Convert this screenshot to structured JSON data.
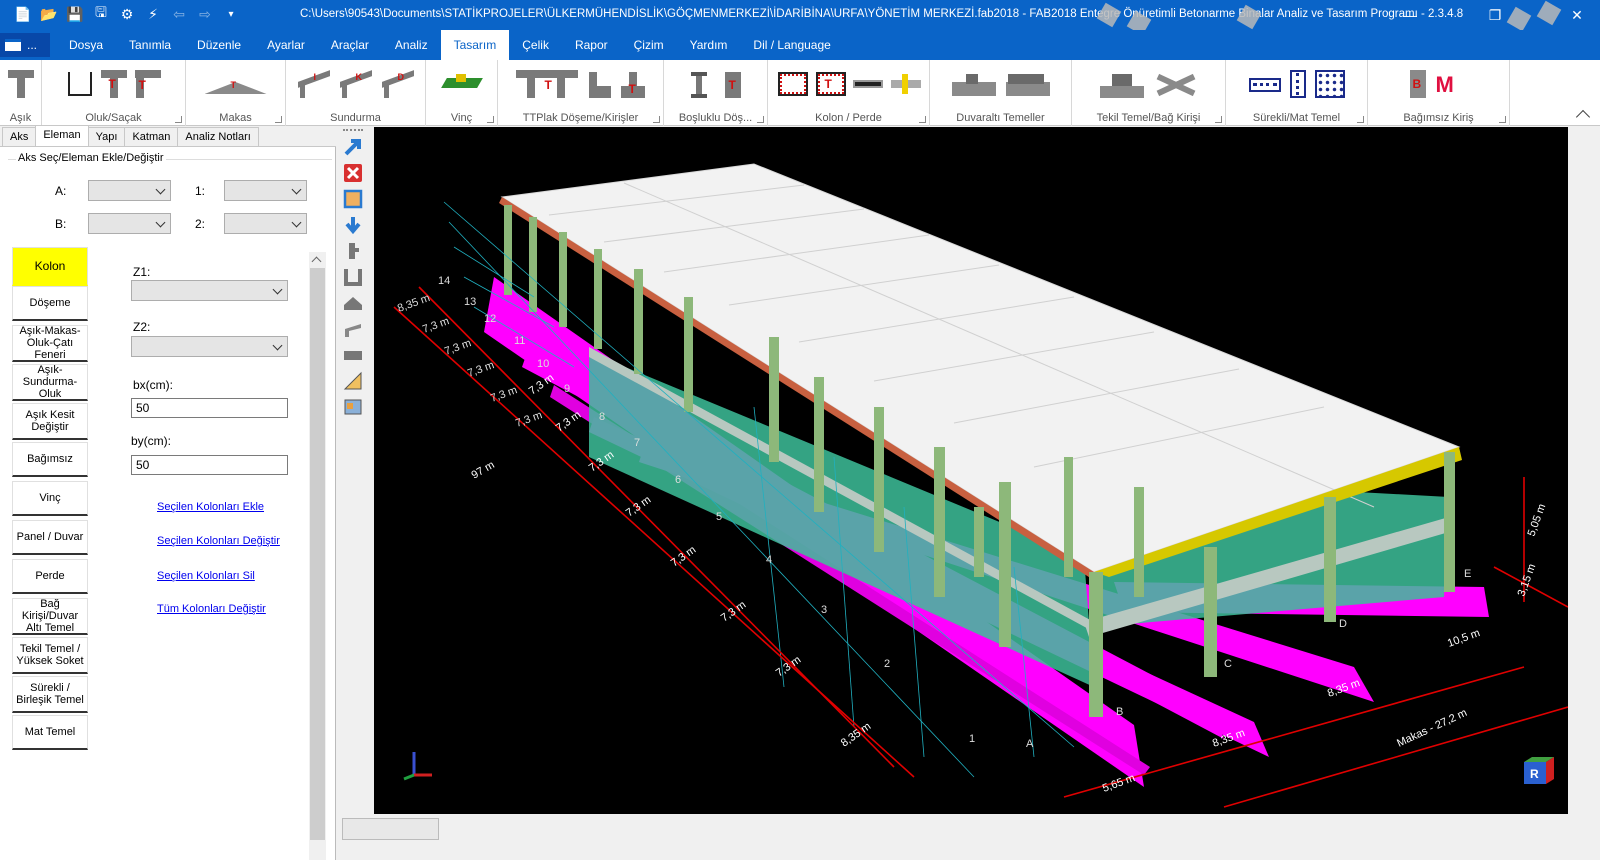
{
  "titlebar": {
    "path": "C:\\Users\\90543\\Documents\\STATİKPROJELER\\ÜLKERMÜHENDİSLİK\\GÖÇMENMERKEZİ\\İDARİBİNA\\URFA\\YÖNETİM MERKEZİ.fab2018 - FAB2018 Entegre Önüretimli Betonarme Binalar Analiz ve Tasarım Programı  - 2.3.4.8",
    "minimize": "—",
    "maximize": "❐",
    "close": "✕"
  },
  "menu": {
    "app_button": "...",
    "items": [
      "Dosya",
      "Tanımla",
      "Düzenle",
      "Ayarlar",
      "Araçlar",
      "Analiz",
      "Tasarım",
      "Çelik",
      "Rapor",
      "Çizim",
      "Yardım",
      "Dil / Language"
    ],
    "active": "Tasarım"
  },
  "ribbon": {
    "groups": [
      "Aşık",
      "Oluk/Saçak",
      "Makas",
      "Sundurma",
      "Vinç",
      "TTPlak Döşeme/Kirişler",
      "Boşluklu Döş...",
      "Kolon / Perde",
      "Duvaraltı Temeller",
      "Tekil Temel/Bağ Kirişi",
      "Sürekli/Mat Temel",
      "Bağımsız Kiriş"
    ],
    "accent_red": "#d01010"
  },
  "left_tabs": [
    "Aks",
    "Eleman",
    "Yapı",
    "Katman",
    "Analiz Notları"
  ],
  "left_tabs_active": "Eleman",
  "panel": {
    "group_title": "Aks Seç/Eleman Ekle/Değiştir",
    "axis_a_label": "A:",
    "axis_b_label": "B:",
    "axis_1_label": "1:",
    "axis_2_label": "2:",
    "z1_label": "Z1:",
    "z2_label": "Z2:",
    "bx_label": "bx(cm):",
    "bx_value": "50",
    "by_label": "by(cm):",
    "by_value": "50",
    "links": [
      "Seçilen Kolonları Ekle",
      "Seçilen Kolonları Değiştir",
      "Seçilen Kolonları Sil",
      "Tüm Kolonları Değiştir"
    ]
  },
  "elements": [
    "Kolon",
    "Döşeme",
    "Aşık-Makas-Oluk-Çatı Feneri",
    "Aşık-Sundurma-Oluk",
    "Aşık Kesit Değiştir",
    "Bağımsız",
    "Vinç",
    "Panel / Duvar",
    "Perde",
    "Bağ Kirişi/Duvar Altı Temel",
    "Tekil Temel / Yüksek Soket",
    "Sürekli / Birleşik Temel",
    "Mat Temel"
  ],
  "elements_active": "Kolon",
  "viewport": {
    "background": "#000000",
    "dims_long": [
      "8,35 m",
      "7,3 m",
      "7,3 m",
      "7,3 m",
      "7,3 m",
      "7,3 m",
      "7,3 m",
      "7,3 m"
    ],
    "dims_short": [
      "5,65 m",
      "8,35 m",
      "8,35 m",
      "10,5 m"
    ],
    "dim_total": "97 m",
    "dim_truss": "Makas - 27,2 m",
    "dim_heights": [
      "5,05 m",
      "3,15 m"
    ],
    "axis_numbers": [
      "1",
      "2",
      "3",
      "4",
      "5",
      "6",
      "7",
      "8",
      "9",
      "10",
      "11",
      "12",
      "13",
      "14"
    ],
    "axis_letters": [
      "A",
      "B",
      "C",
      "D",
      "E"
    ],
    "left_dims": [
      "8,35 m",
      "7,3 m",
      "7,3 m",
      "7,3 m",
      "7,3 m",
      "7,3 m"
    ],
    "cube_label": "R",
    "colors": {
      "footing": "#ff00ff",
      "column": "#8db87a",
      "roof": "#f2f2f2",
      "truss": "#d6c800",
      "slab": "#40c0a0",
      "dim": "#e00000"
    }
  }
}
